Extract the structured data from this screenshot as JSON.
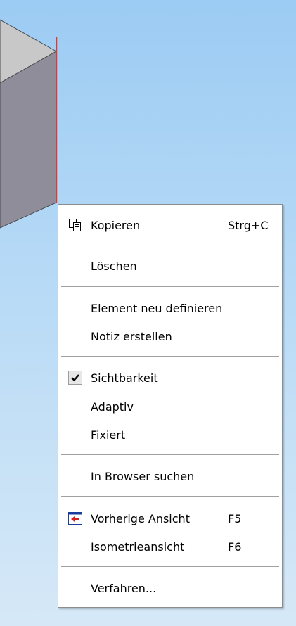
{
  "context_menu": {
    "items": [
      {
        "label": "Kopieren",
        "shortcut": "Strg+C",
        "icon": "copy-icon"
      },
      {
        "label": "Löschen"
      },
      {
        "label": "Element neu definieren"
      },
      {
        "label": "Notiz erstellen"
      },
      {
        "label": "Sichtbarkeit",
        "checked": true,
        "icon": "checkmark-icon"
      },
      {
        "label": "Adaptiv"
      },
      {
        "label": "Fixiert"
      },
      {
        "label": "In Browser suchen"
      },
      {
        "label": "Vorherige Ansicht",
        "shortcut": "F5",
        "icon": "previous-view-icon"
      },
      {
        "label": "Isometrieansicht",
        "shortcut": "F6"
      },
      {
        "label": "Verfahren..."
      }
    ]
  },
  "colors": {
    "background_top": "#9ccbf3",
    "background_bottom": "#d6e8f7",
    "selected_edge": "#e8352b",
    "box_front": "#8d8c99",
    "box_top": "#c7c7c7"
  }
}
